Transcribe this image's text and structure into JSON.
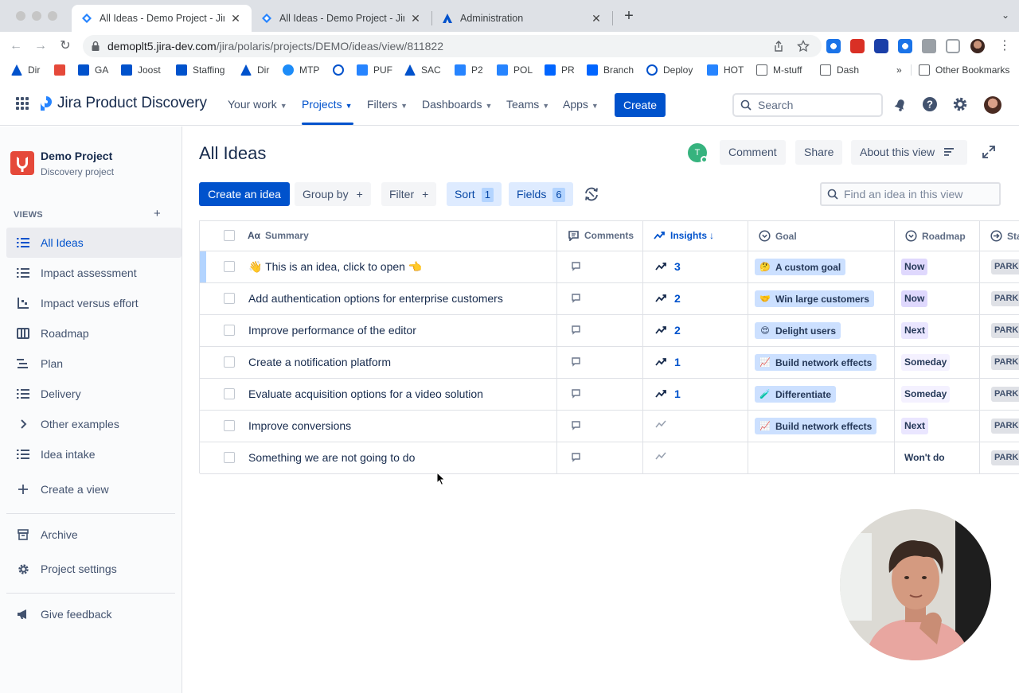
{
  "browser": {
    "tabs": [
      {
        "title": "All Ideas - Demo Project - Jira",
        "active": true
      },
      {
        "title": "All Ideas - Demo Project - Jira",
        "active": false
      },
      {
        "title": "Administration",
        "active": false
      }
    ],
    "url_host": "demoplt5.jira-dev.com",
    "url_path": "/jira/polaris/projects/DEMO/ideas/view/811822",
    "bookmarks": [
      "Dir",
      "GA",
      "Joost",
      "Staffing",
      "Dir",
      "MTP",
      "PUF",
      "SAC",
      "P2",
      "POL",
      "PR",
      "Branch",
      "Deploy",
      "HOT",
      "M-stuff",
      "Dash"
    ],
    "overflow": "»",
    "other_bookmarks": "Other Bookmarks"
  },
  "appnav": {
    "brand": "Jira Product Discovery",
    "items": [
      {
        "label": "Your work"
      },
      {
        "label": "Projects"
      },
      {
        "label": "Filters"
      },
      {
        "label": "Dashboards"
      },
      {
        "label": "Teams"
      },
      {
        "label": "Apps"
      }
    ],
    "create": "Create",
    "search_placeholder": "Search"
  },
  "sidebar": {
    "project_name": "Demo Project",
    "project_type": "Discovery project",
    "views_label": "VIEWS",
    "views_add": "+",
    "items": [
      {
        "label": "All Ideas",
        "icon": "list-icon"
      },
      {
        "label": "Impact assessment",
        "icon": "list-icon"
      },
      {
        "label": "Impact versus effort",
        "icon": "matrix-icon"
      },
      {
        "label": "Roadmap",
        "icon": "board-icon"
      },
      {
        "label": "Plan",
        "icon": "timeline-icon"
      },
      {
        "label": "Delivery",
        "icon": "list-icon"
      },
      {
        "label": "Other examples",
        "icon": "chevron-right-icon"
      },
      {
        "label": "Idea intake",
        "icon": "list-icon"
      }
    ],
    "create_view": "Create a view",
    "archive": "Archive",
    "settings": "Project settings",
    "feedback": "Give feedback"
  },
  "main": {
    "title": "All Ideas",
    "viewer_initial": "T",
    "comment": "Comment",
    "share": "Share",
    "about": "About this view",
    "create_idea": "Create an idea",
    "group_by": "Group by",
    "filter": "Filter",
    "sort": "Sort",
    "sort_count": "1",
    "fields": "Fields",
    "fields_count": "6",
    "plus": "+",
    "find_placeholder": "Find an idea in this view"
  },
  "table": {
    "columns": [
      "Summary",
      "Comments",
      "Insights",
      "Goal",
      "Roadmap",
      "Sta"
    ],
    "sort_arrow": "↓",
    "rows": [
      {
        "summary": "👋 This is an idea, click to open 👈",
        "insights": "3",
        "goal": "A custom goal",
        "goal_emoji": "🤔",
        "roadmap": "Now",
        "status": "PARKED"
      },
      {
        "summary": "Add authentication options for enterprise customers",
        "insights": "2",
        "goal": "Win large customers",
        "goal_emoji": "🤝",
        "roadmap": "Now",
        "status": "PARKED"
      },
      {
        "summary": "Improve performance of the editor",
        "insights": "2",
        "goal": "Delight users",
        "goal_emoji": "😍",
        "roadmap": "Next",
        "status": "PARKED"
      },
      {
        "summary": "Create a notification platform",
        "insights": "1",
        "goal": "Build network effects",
        "goal_emoji": "📈",
        "roadmap": "Someday",
        "status": "PARKED"
      },
      {
        "summary": "Evaluate acquisition options for a video solution",
        "insights": "1",
        "goal": "Differentiate",
        "goal_emoji": "🧪",
        "roadmap": "Someday",
        "status": "PARKED"
      },
      {
        "summary": "Improve conversions",
        "insights": "",
        "goal": "Build network effects",
        "goal_emoji": "📈",
        "roadmap": "Next",
        "status": "PARKED"
      },
      {
        "summary": "Something we are not going to do",
        "insights": "",
        "goal": "",
        "goal_emoji": "",
        "roadmap": "Won't do",
        "status": "PARKED"
      }
    ]
  },
  "colors": {
    "brand_blue": "#0052CC",
    "now": "#DFD8FD",
    "next": "#EAE6FF",
    "goal_tag": "#CCE0FF"
  }
}
